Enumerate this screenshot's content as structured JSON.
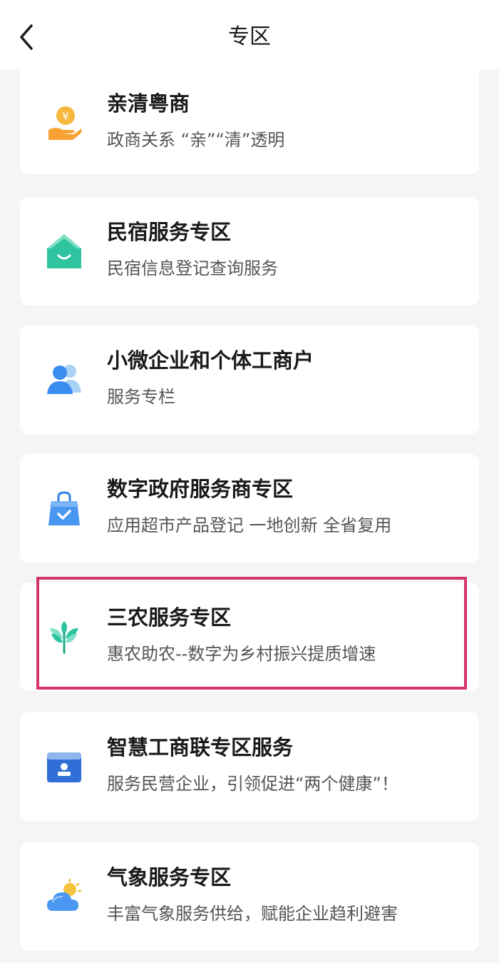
{
  "header": {
    "title": "专区",
    "back_icon": "chevron-left-icon"
  },
  "cards": [
    {
      "title": "亲清粤商",
      "subtitle": "政商关系 “亲”“清”透明",
      "icon": "coin-hand-icon"
    },
    {
      "title": "民宿服务专区",
      "subtitle": "民宿信息登记查询服务",
      "icon": "house-icon"
    },
    {
      "title": "小微企业和个体工商户",
      "subtitle": "服务专栏",
      "icon": "users-icon"
    },
    {
      "title": "数字政府服务商专区",
      "subtitle": "应用超市产品登记 一地创新 全省复用",
      "icon": "shopping-bag-check-icon"
    },
    {
      "title": "三农服务专区",
      "subtitle": "惠农助农--数字为乡村振兴提质增速",
      "icon": "sprout-icon"
    },
    {
      "title": "智慧工商联专区服务",
      "subtitle": "服务民营企业，引领促进“两个健康”！",
      "icon": "id-folder-icon"
    },
    {
      "title": "气象服务专区",
      "subtitle": "丰富气象服务供给，赋能企业趋利避害",
      "icon": "sun-cloud-icon"
    }
  ],
  "highlighted_card": "三农服务专区",
  "colors": {
    "highlight_border": "#d6336c",
    "background": "#f5f5f6"
  }
}
